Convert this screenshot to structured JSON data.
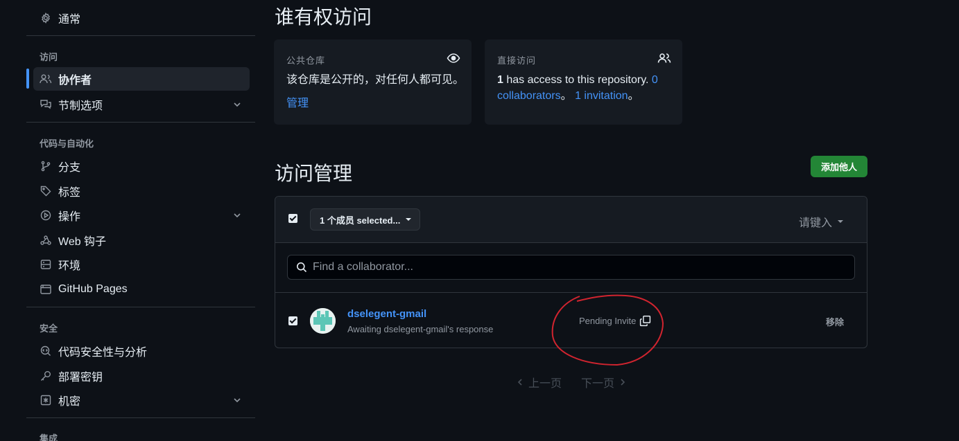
{
  "sidebar": {
    "items": [
      {
        "label": "通常"
      },
      {
        "label": "协作者"
      },
      {
        "label": "节制选项"
      },
      {
        "label": "分支"
      },
      {
        "label": "标签"
      },
      {
        "label": "操作"
      },
      {
        "label": "Web 钩子"
      },
      {
        "label": "环境"
      },
      {
        "label": "GitHub Pages"
      },
      {
        "label": "代码安全性与分析"
      },
      {
        "label": "部署密钥"
      },
      {
        "label": "机密"
      }
    ],
    "sections": {
      "access": "访问",
      "code_automation": "代码与自动化",
      "security": "安全",
      "integrations": "集成"
    }
  },
  "main": {
    "who_has_access_title": "谁有权访问",
    "public_card": {
      "heading": "公共仓库",
      "text": "该仓库是公开的，对任何人都可见。",
      "link": "管理"
    },
    "direct_card": {
      "heading": "直接访问",
      "count": "1",
      "text_part1": " has access to this repository. ",
      "collab_link": "0 collaborators",
      "sep": "。 ",
      "invite_link": "1 invitation",
      "end": "。"
    },
    "manage_title": "访问管理",
    "add_button": "添加他人",
    "selected_label": "1 个成员 selected...",
    "type_label": "请键入",
    "search_placeholder": "Find a collaborator...",
    "collaborator": {
      "name": "dselegent-gmail",
      "status": "Awaiting dselegent-gmail's response",
      "pending": "Pending Invite",
      "remove": "移除"
    },
    "pagination": {
      "prev": "上一页",
      "next": "下一页"
    }
  },
  "colors": {
    "accent": "#4493f8",
    "success": "#238636",
    "annotation": "#d1242f"
  }
}
